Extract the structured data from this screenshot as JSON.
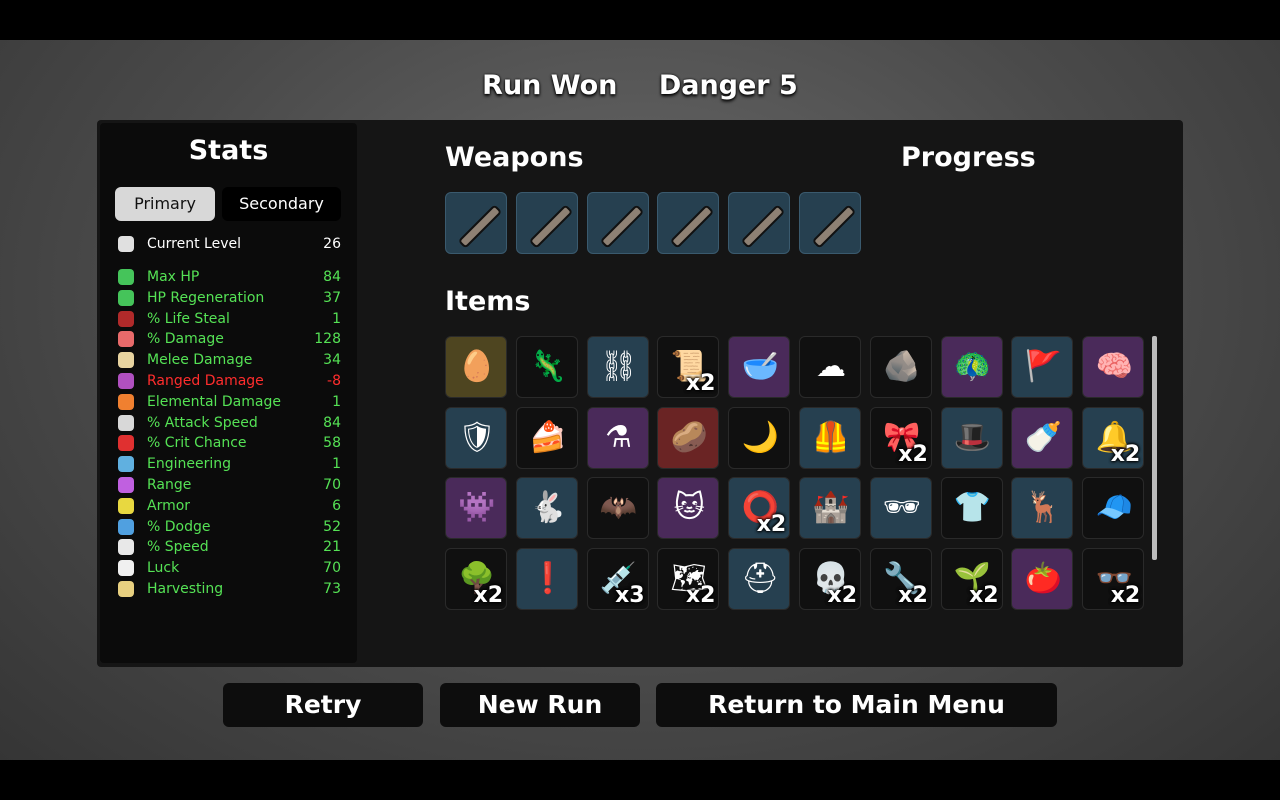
{
  "header": {
    "result": "Run Won",
    "danger": "Danger 5"
  },
  "stats": {
    "title": "Stats",
    "tabs": {
      "primary": "Primary",
      "secondary": "Secondary"
    },
    "rows": [
      {
        "label": "Current Level",
        "value": "26",
        "color": "#ffffff",
        "icon": "level-icon",
        "icon_color": "#e0e0e0"
      },
      {
        "label": "Max HP",
        "value": "84",
        "color": "#55e255",
        "icon": "heart-icon",
        "icon_color": "#45c45a"
      },
      {
        "label": "HP Regeneration",
        "value": "37",
        "color": "#55e255",
        "icon": "regen-heart-icon",
        "icon_color": "#45c45a"
      },
      {
        "label": "% Life Steal",
        "value": "1",
        "color": "#55e255",
        "icon": "fangs-icon",
        "icon_color": "#b02a2a"
      },
      {
        "label": "% Damage",
        "value": "128",
        "color": "#55e255",
        "icon": "muscle-icon",
        "icon_color": "#e86a6a"
      },
      {
        "label": "Melee Damage",
        "value": "34",
        "color": "#55e255",
        "icon": "sword-icon",
        "icon_color": "#e8d4a0"
      },
      {
        "label": "Ranged Damage",
        "value": "-8",
        "color": "#ff2d2d",
        "icon": "bow-icon",
        "icon_color": "#b050c0"
      },
      {
        "label": "Elemental Damage",
        "value": "1",
        "color": "#55e255",
        "icon": "flame-icon",
        "icon_color": "#f08030"
      },
      {
        "label": "% Attack Speed",
        "value": "84",
        "color": "#55e255",
        "icon": "hourglass-icon",
        "icon_color": "#d8d8d8"
      },
      {
        "label": "% Crit Chance",
        "value": "58",
        "color": "#55e255",
        "icon": "crit-burst-icon",
        "icon_color": "#e03030"
      },
      {
        "label": "Engineering",
        "value": "1",
        "color": "#55e255",
        "icon": "wrench-icon",
        "icon_color": "#60b0e0"
      },
      {
        "label": "Range",
        "value": "70",
        "color": "#55e255",
        "icon": "range-waves-icon",
        "icon_color": "#c060e0"
      },
      {
        "label": "Armor",
        "value": "6",
        "color": "#55e255",
        "icon": "shield-icon",
        "icon_color": "#e8d840"
      },
      {
        "label": "% Dodge",
        "value": "52",
        "color": "#55e255",
        "icon": "dodge-wind-icon",
        "icon_color": "#50a0e0"
      },
      {
        "label": "% Speed",
        "value": "21",
        "color": "#55e255",
        "icon": "boot-icon",
        "icon_color": "#e8e8e8"
      },
      {
        "label": "Luck",
        "value": "70",
        "color": "#55e255",
        "icon": "dice-icon",
        "icon_color": "#f0f0f0"
      },
      {
        "label": "Harvesting",
        "value": "73",
        "color": "#55e255",
        "icon": "wheat-icon",
        "icon_color": "#e8d080"
      }
    ]
  },
  "weapons": {
    "title": "Weapons",
    "slots": [
      "stick-weapon-icon",
      "stick-weapon-icon",
      "stick-weapon-icon",
      "stick-weapon-icon",
      "stick-weapon-icon",
      "stick-weapon-icon"
    ]
  },
  "progress": {
    "title": "Progress"
  },
  "items": {
    "title": "Items",
    "grid": [
      {
        "icon": "egg-icon",
        "tier": 4,
        "glyph": "🥚",
        "count": ""
      },
      {
        "icon": "lizard-icon",
        "tier": 0,
        "glyph": "🦎",
        "count": ""
      },
      {
        "icon": "ring-tower-icon",
        "tier": 1,
        "glyph": "⛓",
        "count": ""
      },
      {
        "icon": "scroll-icon",
        "tier": 0,
        "glyph": "📜",
        "count": "x2"
      },
      {
        "icon": "mortar-pestle-icon",
        "tier": 2,
        "glyph": "🥣",
        "count": ""
      },
      {
        "icon": "cloud-icon",
        "tier": 0,
        "glyph": "☁",
        "count": ""
      },
      {
        "icon": "rock-icon",
        "tier": 0,
        "glyph": "🪨",
        "count": ""
      },
      {
        "icon": "peacock-icon",
        "tier": 2,
        "glyph": "🦚",
        "count": ""
      },
      {
        "icon": "banner-icon",
        "tier": 1,
        "glyph": "🚩",
        "count": ""
      },
      {
        "icon": "brain-icon",
        "tier": 2,
        "glyph": "🧠",
        "count": ""
      },
      {
        "icon": "bracer-icon",
        "tier": 1,
        "glyph": "🛡",
        "count": ""
      },
      {
        "icon": "cake-icon",
        "tier": 0,
        "glyph": "🍰",
        "count": ""
      },
      {
        "icon": "potion-icon",
        "tier": 2,
        "glyph": "⚗",
        "count": ""
      },
      {
        "icon": "potato-icon",
        "tier": 3,
        "glyph": "🥔",
        "count": ""
      },
      {
        "icon": "claw-icon",
        "tier": 0,
        "glyph": "🌙",
        "count": ""
      },
      {
        "icon": "leather-vest-icon",
        "tier": 1,
        "glyph": "🦺",
        "count": ""
      },
      {
        "icon": "bandana-icon",
        "tier": 0,
        "glyph": "🎀",
        "count": "x2"
      },
      {
        "icon": "beret-icon",
        "tier": 1,
        "glyph": "🎩",
        "count": ""
      },
      {
        "icon": "bottle-icon",
        "tier": 2,
        "glyph": "🍼",
        "count": ""
      },
      {
        "icon": "pinwheel-icon",
        "tier": 1,
        "glyph": "🔔",
        "count": "x2"
      },
      {
        "icon": "alien-icon",
        "tier": 2,
        "glyph": "👾",
        "count": ""
      },
      {
        "icon": "bunny-icon",
        "tier": 1,
        "glyph": "🐇",
        "count": ""
      },
      {
        "icon": "bat-icon",
        "tier": 0,
        "glyph": "🦇",
        "count": ""
      },
      {
        "icon": "cat-icon",
        "tier": 2,
        "glyph": "🐱",
        "count": ""
      },
      {
        "icon": "lifebuoy-icon",
        "tier": 1,
        "glyph": "⭕",
        "count": "x2"
      },
      {
        "icon": "sandcastle-icon",
        "tier": 1,
        "glyph": "🏰",
        "count": ""
      },
      {
        "icon": "sunglasses-icon",
        "tier": 1,
        "glyph": "🕶",
        "count": ""
      },
      {
        "icon": "flannel-shirt-icon",
        "tier": 0,
        "glyph": "👕",
        "count": ""
      },
      {
        "icon": "antlers-icon",
        "tier": 1,
        "glyph": "🦌",
        "count": ""
      },
      {
        "icon": "propeller-hat-icon",
        "tier": 0,
        "glyph": "🧢",
        "count": ""
      },
      {
        "icon": "tree-icon",
        "tier": 0,
        "glyph": "🌳",
        "count": "x2"
      },
      {
        "icon": "alarm-slime-icon",
        "tier": 1,
        "glyph": "❗",
        "count": ""
      },
      {
        "icon": "syringe-icon",
        "tier": 0,
        "glyph": "💉",
        "count": "x3"
      },
      {
        "icon": "treasure-map-icon",
        "tier": 0,
        "glyph": "🗺",
        "count": "x2"
      },
      {
        "icon": "helmet-face-icon",
        "tier": 1,
        "glyph": "⛑",
        "count": ""
      },
      {
        "icon": "skull-icon",
        "tier": 0,
        "glyph": "💀",
        "count": "x2"
      },
      {
        "icon": "needle-icon",
        "tier": 0,
        "glyph": "🔧",
        "count": "x2"
      },
      {
        "icon": "sprout-icon",
        "tier": 0,
        "glyph": "🌱",
        "count": "x2"
      },
      {
        "icon": "tomato-icon",
        "tier": 2,
        "glyph": "🍅",
        "count": ""
      },
      {
        "icon": "glasses-icon",
        "tier": 0,
        "glyph": "👓",
        "count": "x2"
      }
    ]
  },
  "buttons": {
    "retry": "Retry",
    "new_run": "New Run",
    "main_menu": "Return to Main Menu"
  }
}
